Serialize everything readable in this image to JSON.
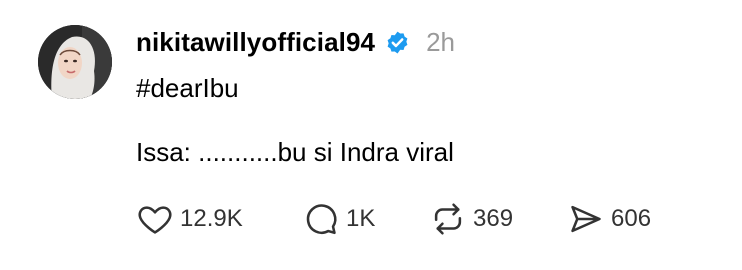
{
  "post": {
    "username": "nikitawillyofficial94",
    "timestamp": "2h",
    "verified_icon": "verified-badge-icon",
    "hashtag": "#dearIbu",
    "text": "Issa: ...........bu si Indra viral"
  },
  "actions": {
    "like_count": "12.9K",
    "reply_count": "1K",
    "repost_count": "369",
    "share_count": "606",
    "icons": [
      "heart-icon",
      "reply-bubble-icon",
      "repost-icon",
      "share-send-icon"
    ]
  },
  "colors": {
    "verified": "#1d9bf0",
    "timestamp": "#9a9a9a",
    "icon_stroke": "#333333"
  }
}
